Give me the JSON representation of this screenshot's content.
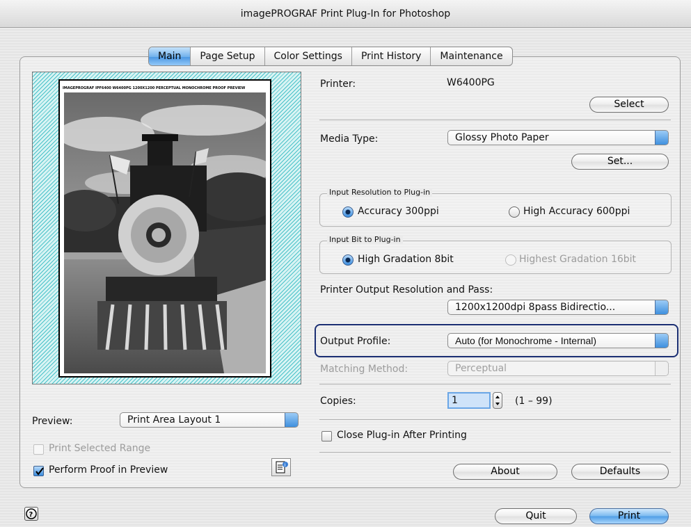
{
  "window": {
    "title": "imagePROGRAF Print Plug-In for Photoshop"
  },
  "tabs": [
    {
      "label": "Main",
      "active": true
    },
    {
      "label": "Page Setup",
      "active": false
    },
    {
      "label": "Color Settings",
      "active": false
    },
    {
      "label": "Print History",
      "active": false
    },
    {
      "label": "Maintenance",
      "active": false
    }
  ],
  "preview": {
    "paper_header_text": "IMAGEPROGRAF IPF6400 W6400PG 1200X1200 PERCEPTUAL MONOCHROME PROOF PREVIEW",
    "label": "Preview:",
    "select_value": "Print Area Layout 1",
    "print_selected_range": "Print Selected Range",
    "perform_proof": "Perform Proof in Preview"
  },
  "printer": {
    "label": "Printer:",
    "value": "W6400PG",
    "select_button": "Select"
  },
  "media": {
    "label": "Media Type:",
    "value": "Glossy Photo Paper",
    "set_button": "Set..."
  },
  "input_resolution": {
    "group_label": "Input Resolution to Plug-in",
    "option1": "Accuracy 300ppi",
    "option2": "High Accuracy 600ppi"
  },
  "input_bit": {
    "group_label": "Input Bit to Plug-in",
    "option1": "High Gradation 8bit",
    "option2": "Highest Gradation 16bit"
  },
  "output_resolution": {
    "label": "Printer Output Resolution and Pass:",
    "value": "1200x1200dpi 8pass Bidirectio..."
  },
  "output_profile": {
    "label": "Output Profile:",
    "value": "Auto (for Monochrome - Internal)"
  },
  "matching": {
    "label": "Matching Method:",
    "value": "Perceptual"
  },
  "copies": {
    "label": "Copies:",
    "value": "1",
    "range": "(1 – 99)"
  },
  "close_after": "Close Plug-in After Printing",
  "buttons": {
    "about": "About",
    "defaults": "Defaults",
    "quit": "Quit",
    "print": "Print"
  },
  "colors": {
    "accent": "#4c98e3",
    "highlight_border": "#1b2f73",
    "preview_hatch": "#49c2c9"
  }
}
